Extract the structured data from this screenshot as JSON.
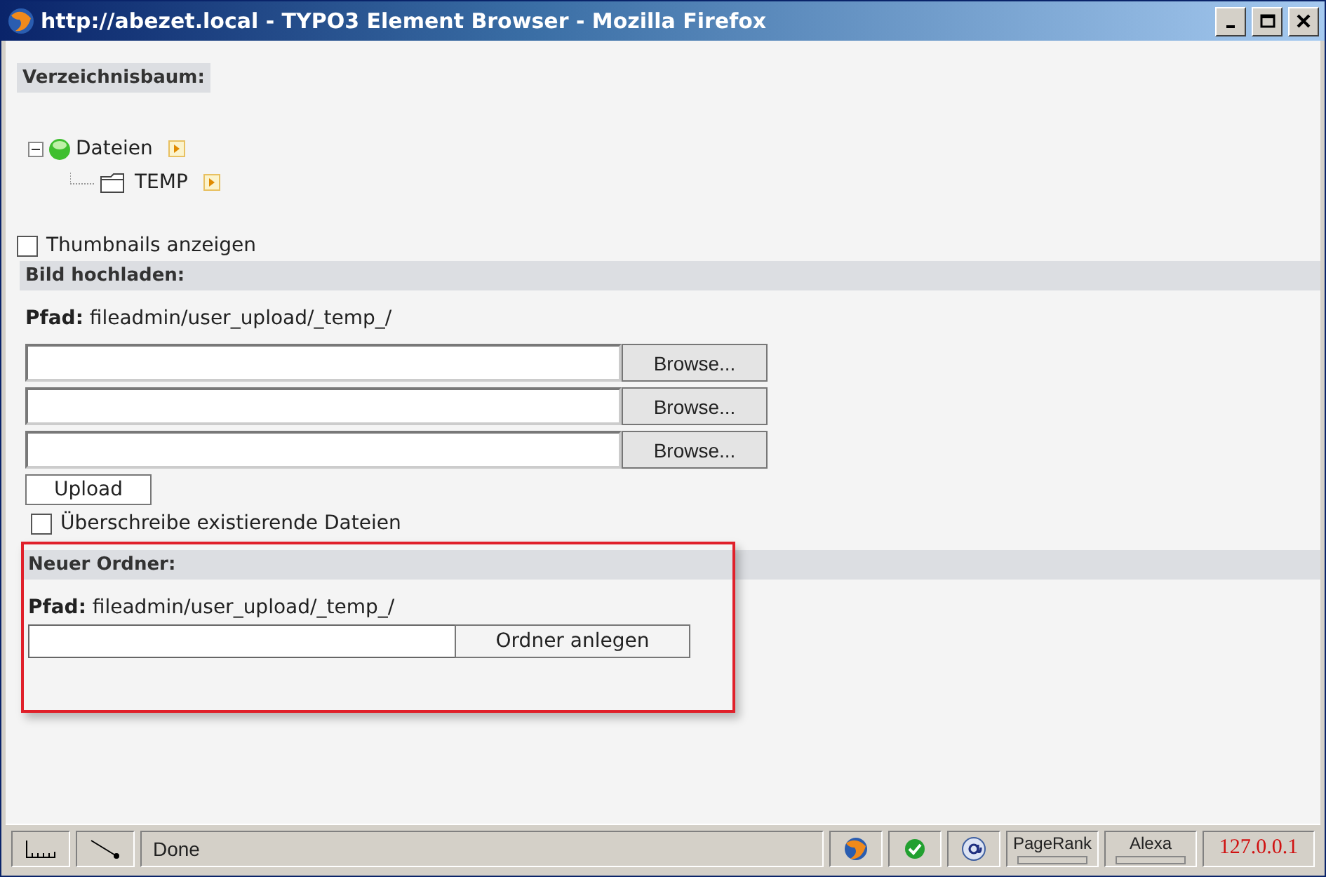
{
  "window": {
    "title": "http://abezet.local - TYPO3 Element Browser - Mozilla Firefox"
  },
  "tree": {
    "heading": "Verzeichnisbaum:",
    "items": [
      {
        "label": "Dateien",
        "expanded": true,
        "kind": "root",
        "children": [
          {
            "label": "TEMP",
            "kind": "folder"
          }
        ]
      }
    ]
  },
  "thumbnails": {
    "label": "Thumbnails anzeigen",
    "checked": false
  },
  "upload": {
    "heading": "Bild hochladen:",
    "path": "**Pfad:** fileadmin/user_upload/_temp_/",
    "files": [
      {
        "button": "Browse..."
      },
      {
        "button": "Browse..."
      },
      {
        "button": "Browse..."
      }
    ],
    "upload_button": "Upload",
    "overwrite": {
      "label": "Überschreibe existierende Dateien",
      "checked": false
    }
  },
  "new_folder": {
    "heading": "Neuer Ordner:",
    "path": "**Pfad:** fileadmin/user_upload/_temp_/",
    "button": "Ordner anlegen",
    "highlighted": true
  },
  "status_bar": {
    "text": "Done",
    "pagerank": "PageRank",
    "alexa": "Alexa",
    "ip": "127.0.0.1"
  }
}
